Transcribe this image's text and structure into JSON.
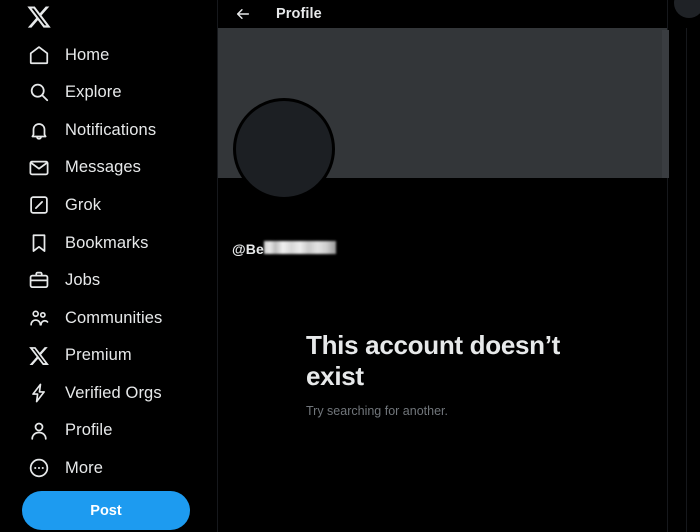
{
  "brand": {
    "logo_icon": "x-logo-icon",
    "accent_color": "#1d9bf0"
  },
  "sidebar": {
    "items": [
      {
        "label": "Home",
        "icon": "home-icon"
      },
      {
        "label": "Explore",
        "icon": "search-icon"
      },
      {
        "label": "Notifications",
        "icon": "bell-icon"
      },
      {
        "label": "Messages",
        "icon": "envelope-icon"
      },
      {
        "label": "Grok",
        "icon": "grok-icon"
      },
      {
        "label": "Bookmarks",
        "icon": "bookmark-icon"
      },
      {
        "label": "Jobs",
        "icon": "briefcase-icon"
      },
      {
        "label": "Communities",
        "icon": "people-icon"
      },
      {
        "label": "Premium",
        "icon": "x-logo-icon"
      },
      {
        "label": "Verified Orgs",
        "icon": "lightning-icon"
      },
      {
        "label": "Profile",
        "icon": "person-icon"
      },
      {
        "label": "More",
        "icon": "more-circle-icon"
      }
    ],
    "post_button_label": "Post"
  },
  "header": {
    "back_icon": "back-arrow-icon",
    "title": "Profile"
  },
  "profile": {
    "banner_color": "#333639",
    "avatar_color": "#1c1f23",
    "handle_visible": "@Be",
    "handle_redacted": true
  },
  "empty_state": {
    "title": "This account doesn’t exist",
    "subtitle": "Try searching for another."
  }
}
